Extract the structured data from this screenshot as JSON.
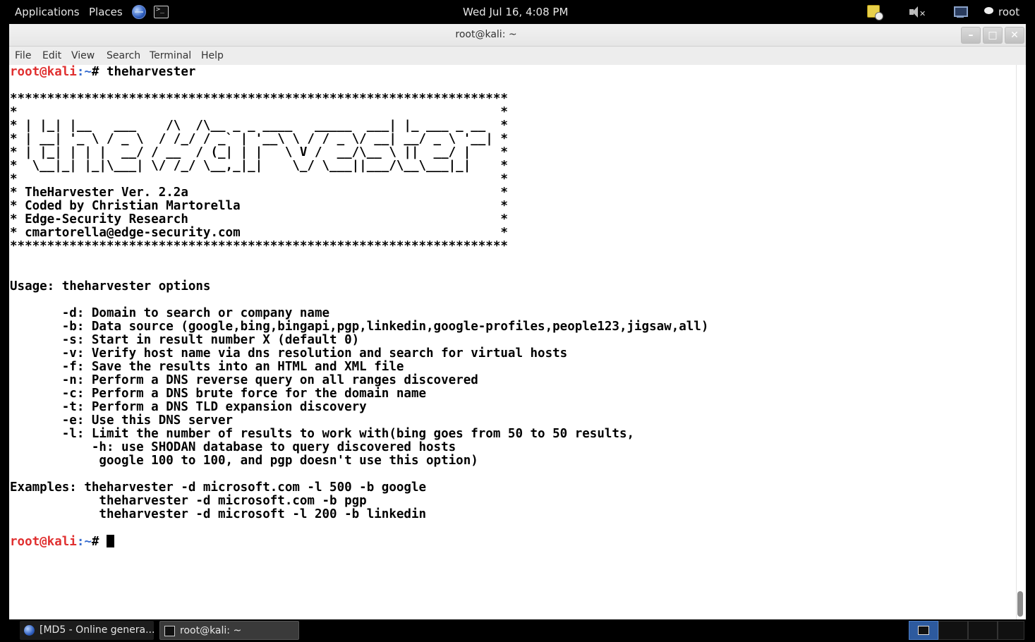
{
  "top_panel": {
    "applications": "Applications",
    "places": "Places",
    "clock": "Wed Jul 16,  4:08 PM",
    "user": "root",
    "volume_mute_mark": "✕"
  },
  "window": {
    "title": "root@kali: ~",
    "minimize": "–",
    "maximize": "□",
    "close": "✕"
  },
  "menubar": {
    "file": "File",
    "edit": "Edit",
    "view": "View",
    "search": "Search",
    "terminal": "Terminal",
    "help": "Help"
  },
  "terminal": {
    "prompt_user": "root@kali",
    "prompt_path": ":~",
    "prompt_symbol": "# ",
    "command": "theharvester",
    "banner": [
      "*******************************************************************",
      "*                                                                 *",
      "* | |_| |__   ___    /\\  /\\__ _ _ ____   _____  ___| |_ ___ _ __  *",
      "* | __| '_ \\ / _ \\  / /_/ / _` | '__\\ \\ / / _ \\/ __| __/ _ \\ '__| *",
      "* | |_| | | |  __/ / __  / (_| | |   \\ V /  __/\\__ \\ ||  __/ |    *",
      "*  \\__|_| |_|\\___| \\/ /_/ \\__,_|_|    \\_/ \\___||___/\\__\\___|_|    *",
      "*                                                                 *",
      "* TheHarvester Ver. 2.2a                                          *",
      "* Coded by Christian Martorella                                   *",
      "* Edge-Security Research                                          *",
      "* cmartorella@edge-security.com                                   *",
      "*******************************************************************"
    ],
    "usage": "Usage: theharvester options",
    "options": [
      "       -d: Domain to search or company name",
      "       -b: Data source (google,bing,bingapi,pgp,linkedin,google-profiles,people123,jigsaw,all)",
      "       -s: Start in result number X (default 0)",
      "       -v: Verify host name via dns resolution and search for virtual hosts",
      "       -f: Save the results into an HTML and XML file",
      "       -n: Perform a DNS reverse query on all ranges discovered",
      "       -c: Perform a DNS brute force for the domain name",
      "       -t: Perform a DNS TLD expansion discovery",
      "       -e: Use this DNS server",
      "       -l: Limit the number of results to work with(bing goes from 50 to 50 results,",
      "           -h: use SHODAN database to query discovered hosts",
      "            google 100 to 100, and pgp doesn't use this option)"
    ],
    "examples": [
      "Examples: theharvester -d microsoft.com -l 500 -b google",
      "            theharvester -d microsoft.com -b pgp",
      "            theharvester -d microsoft -l 200 -b linkedin"
    ]
  },
  "taskbar": {
    "browser_task": "[MD5 - Online genera...",
    "terminal_task": "root@kali: ~"
  }
}
